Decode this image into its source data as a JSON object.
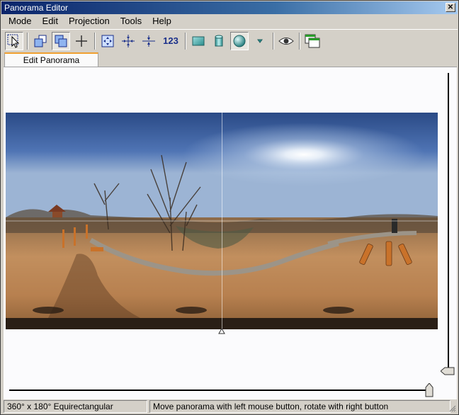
{
  "window": {
    "title": "Panorama Editor"
  },
  "menu": {
    "items": [
      {
        "id": "mode",
        "label": "Mode"
      },
      {
        "id": "edit",
        "label": "Edit"
      },
      {
        "id": "projection",
        "label": "Projection"
      },
      {
        "id": "tools",
        "label": "Tools"
      },
      {
        "id": "help",
        "label": "Help"
      }
    ]
  },
  "toolbar": {
    "buttons": [
      {
        "icon": "select-pointer-icon",
        "pressed": true
      },
      {
        "icon": "front-image-icon",
        "pressed": false
      },
      {
        "icon": "back-image-icon",
        "pressed": true
      },
      {
        "icon": "crosshair-icon",
        "pressed": false
      },
      {
        "icon": "fit-to-window-icon",
        "pressed": false
      },
      {
        "icon": "center-icon",
        "pressed": false
      },
      {
        "icon": "straighten-horizon-icon",
        "pressed": false
      },
      {
        "icon": "numeric-input-icon",
        "label": "123",
        "pressed": false
      },
      {
        "icon": "rectilinear-projection-icon",
        "pressed": false
      },
      {
        "icon": "cylindrical-projection-icon",
        "pressed": false
      },
      {
        "icon": "spherical-projection-icon",
        "pressed": true
      },
      {
        "icon": "projection-dropdown-icon",
        "pressed": false
      },
      {
        "icon": "preview-eye-icon",
        "pressed": false
      },
      {
        "icon": "window-layout-icon",
        "pressed": false
      }
    ],
    "accent": "#1a2f8a"
  },
  "tabs": [
    {
      "label": "Edit Panorama",
      "active": true
    }
  ],
  "canvas": {
    "image_description_type": "equirectangular-panorama"
  },
  "status": {
    "projection": "360° x 180° Equirectangular",
    "hint": "Move panorama with left mouse button, rotate with right button"
  },
  "colors": {
    "tab_accent": "#f0a030",
    "titlebar": "#0a246a"
  }
}
